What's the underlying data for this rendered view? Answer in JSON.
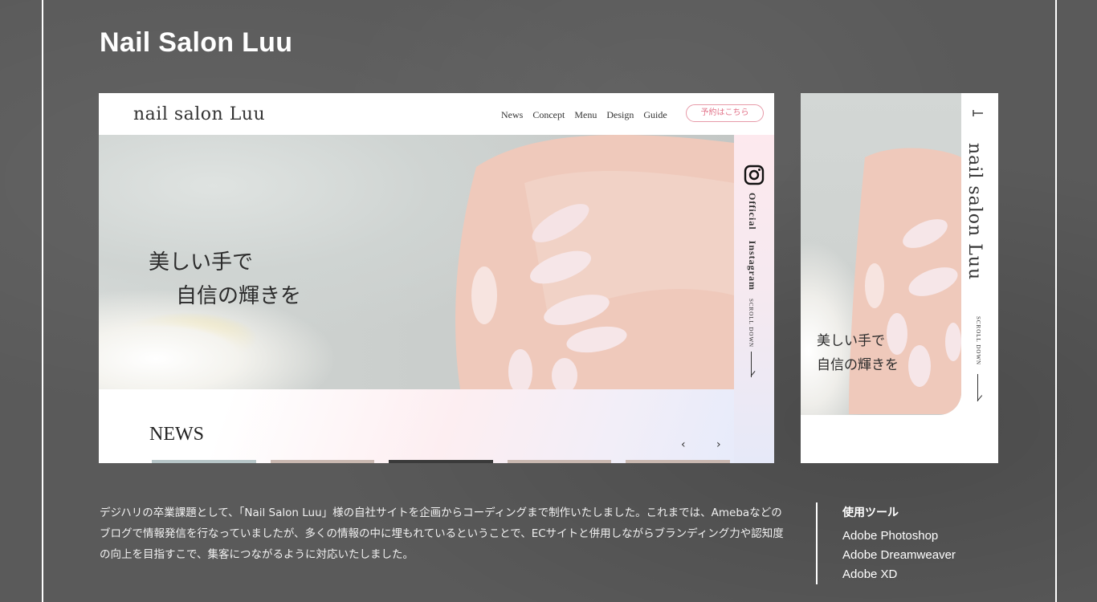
{
  "page": {
    "title": "Nail Salon Luu"
  },
  "desktop": {
    "logo": "nail salon Luu",
    "nav": [
      "News",
      "Concept",
      "Menu",
      "Design",
      "Guide"
    ],
    "reserve_label": "予約はこちら",
    "hero_line1": "美しい手で",
    "hero_line2": "自信の輝きを",
    "side_label": "Official　Instagram",
    "scroll_label": "SCROLL DOWN",
    "news_title": "NEWS",
    "prev_arrow": "‹",
    "next_arrow": "›"
  },
  "mobile": {
    "logo": "nail salon Luu",
    "hero_line1": "美しい手で",
    "hero_line2": "自信の輝きを",
    "scroll_label": "SCROLL DOWN"
  },
  "description": {
    "text": "デジハリの卒業課題として、「Nail Salon Luu」様の自社サイトを企画からコーディングまで制作いたしました。これまでは、Amebaなどのブログで情報発信を行なっていましたが、多くの情報の中に埋もれているということで、ECサイトと併用しながらブランディング力や認知度の向上を目指すこで、集客につながるように対応いたしました。"
  },
  "tools": {
    "heading": "使用ツール",
    "items": [
      "Adobe Photoshop",
      "Adobe Dreamweaver",
      "Adobe XD"
    ]
  },
  "colors": {
    "background": "#5a5a5a",
    "accent_pink": "#e27389",
    "frame": "#ffffff"
  }
}
